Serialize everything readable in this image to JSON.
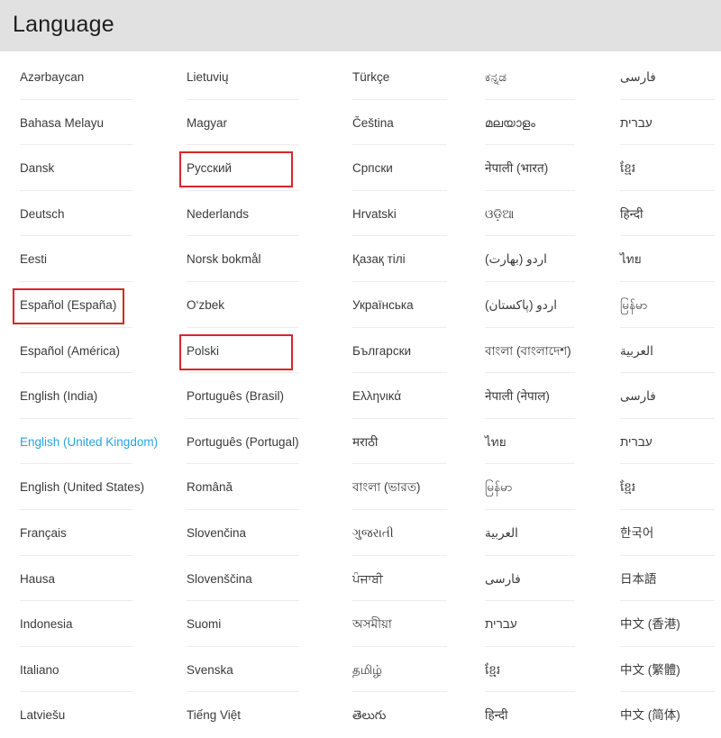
{
  "header": {
    "title": "Language"
  },
  "colors": {
    "accent": "#29a3dd",
    "highlight": "#d9252c"
  },
  "columns": [
    {
      "items": [
        {
          "label": "Azərbaycan"
        },
        {
          "label": "Bahasa Melayu"
        },
        {
          "label": "Dansk"
        },
        {
          "label": "Deutsch"
        },
        {
          "label": "Eesti"
        },
        {
          "label": "Español (España)",
          "highlighted": true
        },
        {
          "label": "Español (América)"
        },
        {
          "label": "English (India)"
        },
        {
          "label": "English (United Kingdom)",
          "selected": true
        },
        {
          "label": "English (United States)"
        },
        {
          "label": "Français"
        },
        {
          "label": "Hausa"
        },
        {
          "label": "Indonesia"
        },
        {
          "label": "Italiano"
        },
        {
          "label": "Latviešu"
        }
      ]
    },
    {
      "items": [
        {
          "label": "Lietuvių"
        },
        {
          "label": "Magyar"
        },
        {
          "label": "Русский",
          "highlighted": true
        },
        {
          "label": "Nederlands"
        },
        {
          "label": "Norsk bokmål"
        },
        {
          "label": "O‘zbek"
        },
        {
          "label": "Polski",
          "highlighted": true
        },
        {
          "label": "Português (Brasil)"
        },
        {
          "label": "Português (Portugal)"
        },
        {
          "label": "Română"
        },
        {
          "label": "Slovenčina"
        },
        {
          "label": "Slovenščina"
        },
        {
          "label": "Suomi"
        },
        {
          "label": "Svenska"
        },
        {
          "label": "Tiếng Việt"
        }
      ]
    },
    {
      "items": [
        {
          "label": "Türkçe"
        },
        {
          "label": "Čeština"
        },
        {
          "label": "Српски"
        },
        {
          "label": "Hrvatski"
        },
        {
          "label": "Қазақ тілі"
        },
        {
          "label": "Українська"
        },
        {
          "label": "Български"
        },
        {
          "label": "Ελληνικά"
        },
        {
          "label": "मराठी"
        },
        {
          "label": "বাংলা (ভারত)"
        },
        {
          "label": "ગુજરાતી"
        },
        {
          "label": "ਪੰਜਾਬੀ"
        },
        {
          "label": "অসমীয়া"
        },
        {
          "label": "தமிழ்"
        },
        {
          "label": "తెలుగు"
        }
      ]
    },
    {
      "items": [
        {
          "label": "ಕನ್ನಡ"
        },
        {
          "label": "മലയാളം"
        },
        {
          "label": "नेपाली (भारत)"
        },
        {
          "label": "ଓଡ଼ିଆ"
        },
        {
          "label": "اردو (بھارت)"
        },
        {
          "label": "اردو (پاکستان)"
        },
        {
          "label": "বাংলা (বাংলাদেশ)"
        },
        {
          "label": "नेपाली (नेपाल)"
        },
        {
          "label": "ไทย"
        },
        {
          "label": "မြန်မာ"
        },
        {
          "label": "العربية"
        },
        {
          "label": "فارسی"
        },
        {
          "label": "עברית"
        },
        {
          "label": "ខ្មែរ"
        },
        {
          "label": "हिन्दी"
        }
      ]
    },
    {
      "items": [
        {
          "label": "فارسی"
        },
        {
          "label": "עברית"
        },
        {
          "label": "ខ្មែរ"
        },
        {
          "label": "हिन्दी"
        },
        {
          "label": "ไทย"
        },
        {
          "label": "မြန်မာ"
        },
        {
          "label": "العربية"
        },
        {
          "label": "فارسی"
        },
        {
          "label": "עברית"
        },
        {
          "label": "ខ្មែរ"
        },
        {
          "label": "한국어"
        },
        {
          "label": "日本語"
        },
        {
          "label": "中文 (香港)"
        },
        {
          "label": "中文 (繁體)"
        },
        {
          "label": "中文 (简体)"
        }
      ]
    }
  ]
}
